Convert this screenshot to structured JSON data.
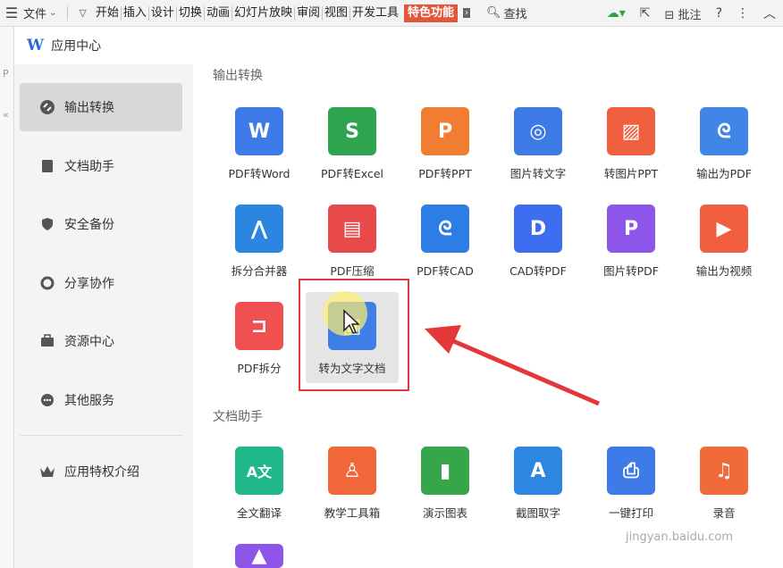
{
  "menubar": {
    "file": "文件",
    "items": [
      "开始",
      "插入",
      "设计",
      "切换",
      "动画",
      "幻灯片放映",
      "审阅",
      "视图",
      "开发工具"
    ],
    "highlight": "特色功能",
    "search": "查找",
    "annotate": "批注"
  },
  "dialog": {
    "title": "应用中心"
  },
  "sidebar": {
    "items": [
      {
        "label": "输出转换",
        "icon": "convert-icon"
      },
      {
        "label": "文档助手",
        "icon": "doc-icon"
      },
      {
        "label": "安全备份",
        "icon": "shield-icon"
      },
      {
        "label": "分享协作",
        "icon": "share-icon"
      },
      {
        "label": "资源中心",
        "icon": "briefcase-icon"
      },
      {
        "label": "其他服务",
        "icon": "more-icon"
      }
    ],
    "privilege": "应用特权介绍"
  },
  "sections": {
    "output": {
      "title": "输出转换",
      "tiles": [
        {
          "label": "PDF转Word",
          "color": "#3f7be8",
          "glyph": "W"
        },
        {
          "label": "PDF转Excel",
          "color": "#2ea44f",
          "glyph": "S"
        },
        {
          "label": "PDF转PPT",
          "color": "#f07d31",
          "glyph": "P"
        },
        {
          "label": "图片转文字",
          "color": "#3d7ae6",
          "glyph": "◎"
        },
        {
          "label": "转图片PPT",
          "color": "#f05f3e",
          "glyph": "▨"
        },
        {
          "label": "输出为PDF",
          "color": "#3f86e8",
          "glyph": "ᘓ"
        },
        {
          "label": "拆分合并器",
          "color": "#2b86e0",
          "glyph": "⋀"
        },
        {
          "label": "PDF压缩",
          "color": "#e84a4a",
          "glyph": "▤"
        },
        {
          "label": "PDF转CAD",
          "color": "#2c7de6",
          "glyph": "ᘓ"
        },
        {
          "label": "CAD转PDF",
          "color": "#3e6ef0",
          "glyph": "D"
        },
        {
          "label": "图片转PDF",
          "color": "#8d55e8",
          "glyph": "P"
        },
        {
          "label": "输出为视频",
          "color": "#f05f3e",
          "glyph": "▶"
        },
        {
          "label": "PDF拆分",
          "color": "#f0504f",
          "glyph": "⊐"
        },
        {
          "label": "转为文字文档",
          "color": "#3e7ee6",
          "glyph": "▣"
        }
      ]
    },
    "assistant": {
      "title": "文档助手",
      "tiles": [
        {
          "label": "全文翻译",
          "color": "#20b88a",
          "glyph": "A文"
        },
        {
          "label": "教学工具箱",
          "color": "#f0673a",
          "glyph": "♙"
        },
        {
          "label": "演示图表",
          "color": "#36a64a",
          "glyph": "▮"
        },
        {
          "label": "截图取字",
          "color": "#2d86e0",
          "glyph": "A"
        },
        {
          "label": "一键打印",
          "color": "#3f7be8",
          "glyph": "⎙"
        },
        {
          "label": "录音",
          "color": "#f06a3a",
          "glyph": "♫"
        }
      ]
    }
  },
  "watermark": "jingyan.baidu.com"
}
